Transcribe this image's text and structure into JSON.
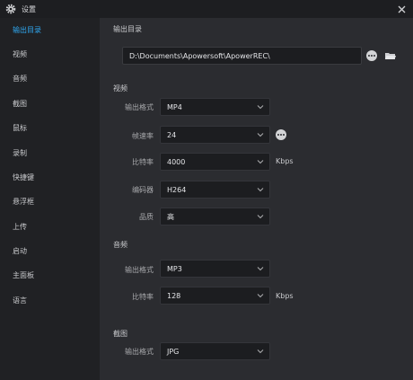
{
  "window": {
    "title": "设置"
  },
  "sidebar": {
    "items": [
      {
        "label": "输出目录",
        "active": true
      },
      {
        "label": "视频"
      },
      {
        "label": "音频"
      },
      {
        "label": "截图"
      },
      {
        "label": "鼠标"
      },
      {
        "label": "录制"
      },
      {
        "label": "快捷键"
      },
      {
        "label": "悬浮框"
      },
      {
        "label": "上传"
      },
      {
        "label": "启动"
      },
      {
        "label": "主面板"
      },
      {
        "label": "语言"
      }
    ]
  },
  "output": {
    "title": "输出目录",
    "path": "D:\\Documents\\Apowersoft\\ApowerREC\\"
  },
  "video": {
    "title": "视频",
    "format": {
      "label": "输出格式",
      "value": "MP4"
    },
    "framerate": {
      "label": "帧速率",
      "value": "24"
    },
    "bitrate": {
      "label": "比特率",
      "value": "4000",
      "unit": "Kbps"
    },
    "encoder": {
      "label": "编码器",
      "value": "H264"
    },
    "quality": {
      "label": "品质",
      "value": "高"
    }
  },
  "audio": {
    "title": "音频",
    "format": {
      "label": "输出格式",
      "value": "MP3"
    },
    "bitrate": {
      "label": "比特率",
      "value": "128",
      "unit": "Kbps"
    }
  },
  "screenshot": {
    "title": "截图",
    "format": {
      "label": "输出格式",
      "value": "JPG"
    }
  },
  "colors": {
    "accent": "#2fa8f0",
    "sidebar_bg": "#202124",
    "panel_bg": "#2b2c30",
    "field_bg": "#1c1d20"
  }
}
